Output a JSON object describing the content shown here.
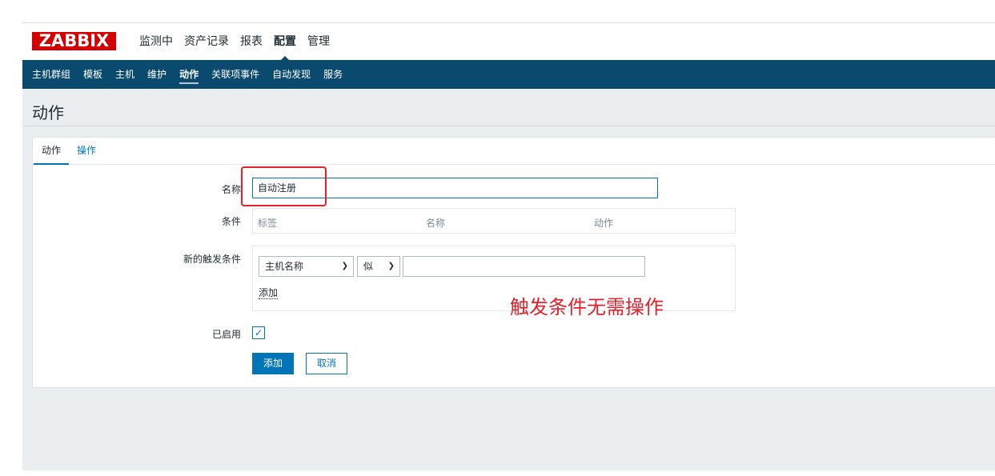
{
  "logo": {
    "text": "ZABBIX",
    "color": "#d40000"
  },
  "main_nav": {
    "items": [
      {
        "label": "监测中",
        "active": false
      },
      {
        "label": "资产记录",
        "active": false
      },
      {
        "label": "报表",
        "active": false
      },
      {
        "label": "配置",
        "active": true
      },
      {
        "label": "管理",
        "active": false
      }
    ]
  },
  "sub_nav": {
    "items": [
      {
        "label": "主机群组",
        "active": false
      },
      {
        "label": "模板",
        "active": false
      },
      {
        "label": "主机",
        "active": false
      },
      {
        "label": "维护",
        "active": false
      },
      {
        "label": "动作",
        "active": true
      },
      {
        "label": "关联项事件",
        "active": false
      },
      {
        "label": "自动发现",
        "active": false
      },
      {
        "label": "服务",
        "active": false
      }
    ],
    "background": "#0b4a6f"
  },
  "page": {
    "title": "动作"
  },
  "tabs": [
    {
      "label": "动作",
      "active": true
    },
    {
      "label": "操作",
      "active": false
    }
  ],
  "form": {
    "name_label": "名称",
    "name_value": "自动注册",
    "conditions_label": "条件",
    "conditions_columns": [
      "标签",
      "名称",
      "动作"
    ],
    "new_condition_label": "新的触发条件",
    "condition_type_selected": "主机名称",
    "condition_operator_selected": "似",
    "condition_value": "",
    "add_condition_link": "添加",
    "enabled_label": "已启用",
    "enabled": true,
    "add_button": "添加",
    "cancel_button": "取消"
  },
  "annotation": {
    "text": "触发条件无需操作",
    "color": "#e5202a"
  },
  "colors": {
    "accent": "#0275b8",
    "background": "#ebeef0"
  }
}
